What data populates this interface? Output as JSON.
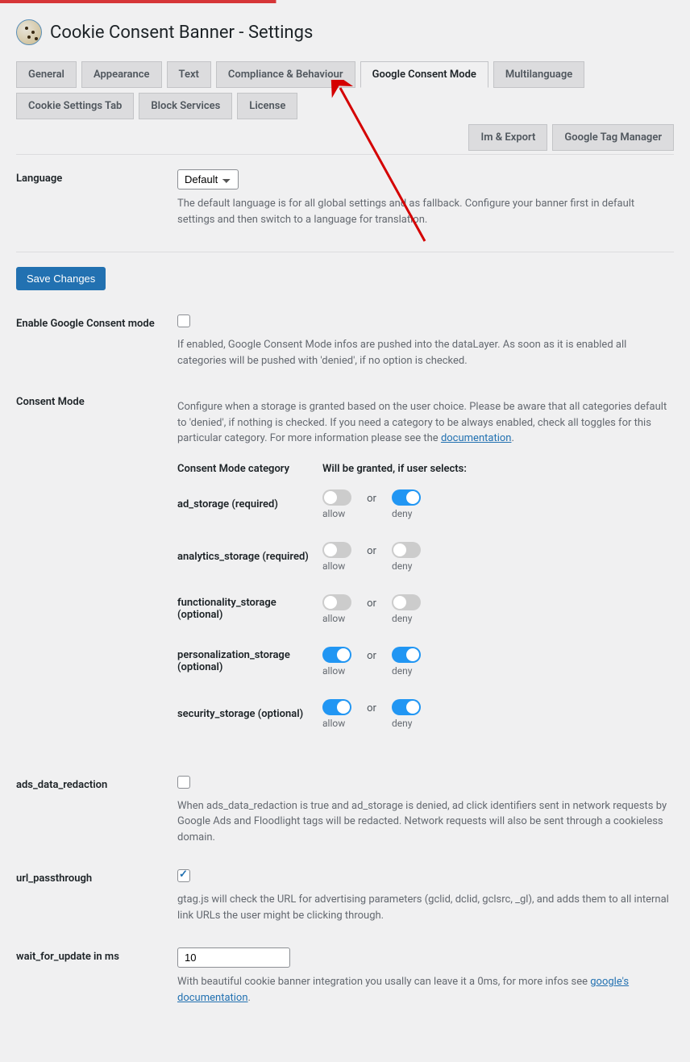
{
  "header": {
    "title": "Cookie Consent Banner - Settings"
  },
  "tabs": {
    "row1": [
      "General",
      "Appearance",
      "Text",
      "Compliance & Behaviour",
      "Google Consent Mode",
      "Multilanguage",
      "Cookie Settings Tab",
      "Block Services",
      "License"
    ],
    "row2": [
      "Im & Export",
      "Google Tag Manager"
    ],
    "active": "Google Consent Mode"
  },
  "language": {
    "label": "Language",
    "value": "Default",
    "desc": "The default language is for all global settings and as fallback. Configure your banner first in default settings and then switch to a language for translation."
  },
  "save_button": "Save Changes",
  "enable_gcm": {
    "label": "Enable Google Consent mode",
    "checked": false,
    "desc": "If enabled, Google Consent Mode infos are pushed into the dataLayer. As soon as it is enabled all categories will be pushed with 'denied', if no option is checked."
  },
  "consent_mode": {
    "label": "Consent Mode",
    "desc_prefix": "Configure when a storage is granted based on the user choice. Please be aware that all categories default to 'denied', if nothing is checked. If you need a category to be always enabled, check all toggles for this particular category. For more information please see the ",
    "doc_link": "documentation",
    "th_category": "Consent Mode category",
    "th_grant": "Will be granted, if user selects:",
    "or_text": "or",
    "allow_text": "allow",
    "deny_text": "deny",
    "rows": [
      {
        "name": "ad_storage (required)",
        "allow": false,
        "deny": true
      },
      {
        "name": "analytics_storage (required)",
        "allow": false,
        "deny": false
      },
      {
        "name": "functionality_storage (optional)",
        "allow": false,
        "deny": false
      },
      {
        "name": "personalization_storage (optional)",
        "allow": true,
        "deny": true
      },
      {
        "name": "security_storage (optional)",
        "allow": true,
        "deny": true
      }
    ]
  },
  "ads_redaction": {
    "label": "ads_data_redaction",
    "checked": false,
    "desc": "When ads_data_redaction is true and ad_storage is denied, ad click identifiers sent in network requests by Google Ads and Floodlight tags will be redacted. Network requests will also be sent through a cookieless domain."
  },
  "url_passthrough": {
    "label": "url_passthrough",
    "checked": true,
    "desc": "gtag.js will check the URL for advertising parameters (gclid, dclid, gclsrc, _gl), and adds them to all internal link URLs the user might be clicking through."
  },
  "wait_update": {
    "label": "wait_for_update in ms",
    "value": "10",
    "desc_prefix": "With beautiful cookie banner integration you usally can leave it a 0ms, for more infos see ",
    "doc_link": "google's documentation"
  }
}
